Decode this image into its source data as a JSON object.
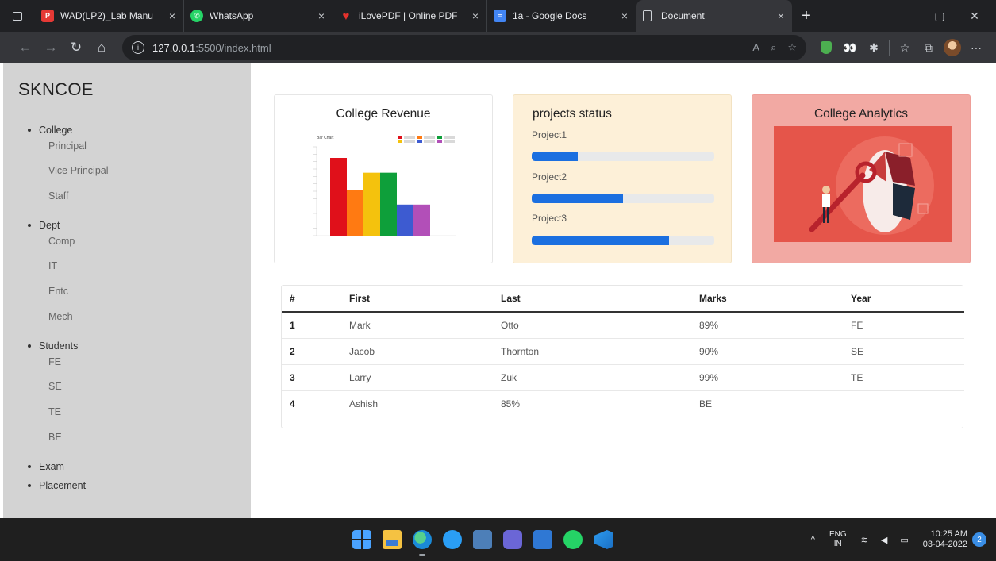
{
  "browser": {
    "tabs": [
      {
        "label": "WAD(LP2)_Lab Manu",
        "icon": "pdf-icon",
        "color": "#e53935"
      },
      {
        "label": "WhatsApp",
        "icon": "whatsapp-icon",
        "color": "#25d366"
      },
      {
        "label": "iLovePDF | Online PDF",
        "icon": "heart-icon",
        "color": "#e5322d"
      },
      {
        "label": "1a - Google Docs",
        "icon": "docs-icon",
        "color": "#4285f4"
      },
      {
        "label": "Document",
        "icon": "page-icon",
        "color": "#9aa0a6"
      }
    ],
    "url_host": "127.0.0.1",
    "url_rest": ":5500/index.html"
  },
  "sidebar": {
    "brand": "SKNCOE",
    "sections": [
      {
        "label": "College",
        "items": [
          "Principal",
          "Vice Principal",
          "Staff"
        ]
      },
      {
        "label": "Dept",
        "items": [
          "Comp",
          "IT",
          "Entc",
          "Mech"
        ]
      },
      {
        "label": "Students",
        "items": [
          "FE",
          "SE",
          "TE",
          "BE"
        ]
      },
      {
        "label": "Exam",
        "items": []
      },
      {
        "label": "Placement",
        "items": []
      }
    ]
  },
  "cards": {
    "revenue": {
      "title": "College Revenue",
      "chart_title": "Bar Chart"
    },
    "projects": {
      "title": "projects status",
      "items": [
        {
          "label": "Project1",
          "progress": 25
        },
        {
          "label": "Project2",
          "progress": 50
        },
        {
          "label": "Project3",
          "progress": 75
        }
      ]
    },
    "analytics": {
      "title": "College Analytics"
    }
  },
  "table": {
    "headers": [
      "#",
      "First",
      "Last",
      "Marks",
      "Year"
    ],
    "rows": [
      [
        "1",
        "Mark",
        "Otto",
        "89%",
        "FE"
      ],
      [
        "2",
        "Jacob",
        "Thornton",
        "90%",
        "SE"
      ],
      [
        "3",
        "Larry",
        "Zuk",
        "99%",
        "TE"
      ],
      [
        "4",
        "Ashish",
        "85%",
        "BE",
        ""
      ]
    ]
  },
  "chart_data": {
    "type": "bar",
    "title": "Bar Chart",
    "values": [
      10.5,
      6.2,
      8.5,
      8.5,
      4.2,
      4.2
    ],
    "colors": [
      "#e0101a",
      "#ff7a12",
      "#f4c20d",
      "#0e9f3a",
      "#3d5bd1",
      "#b24fb8"
    ],
    "ylim": [
      0,
      12
    ]
  },
  "taskbar": {
    "lang_top": "ENG",
    "lang_bottom": "IN",
    "time": "10:25 AM",
    "date": "03-04-2022",
    "notifications": "2"
  }
}
